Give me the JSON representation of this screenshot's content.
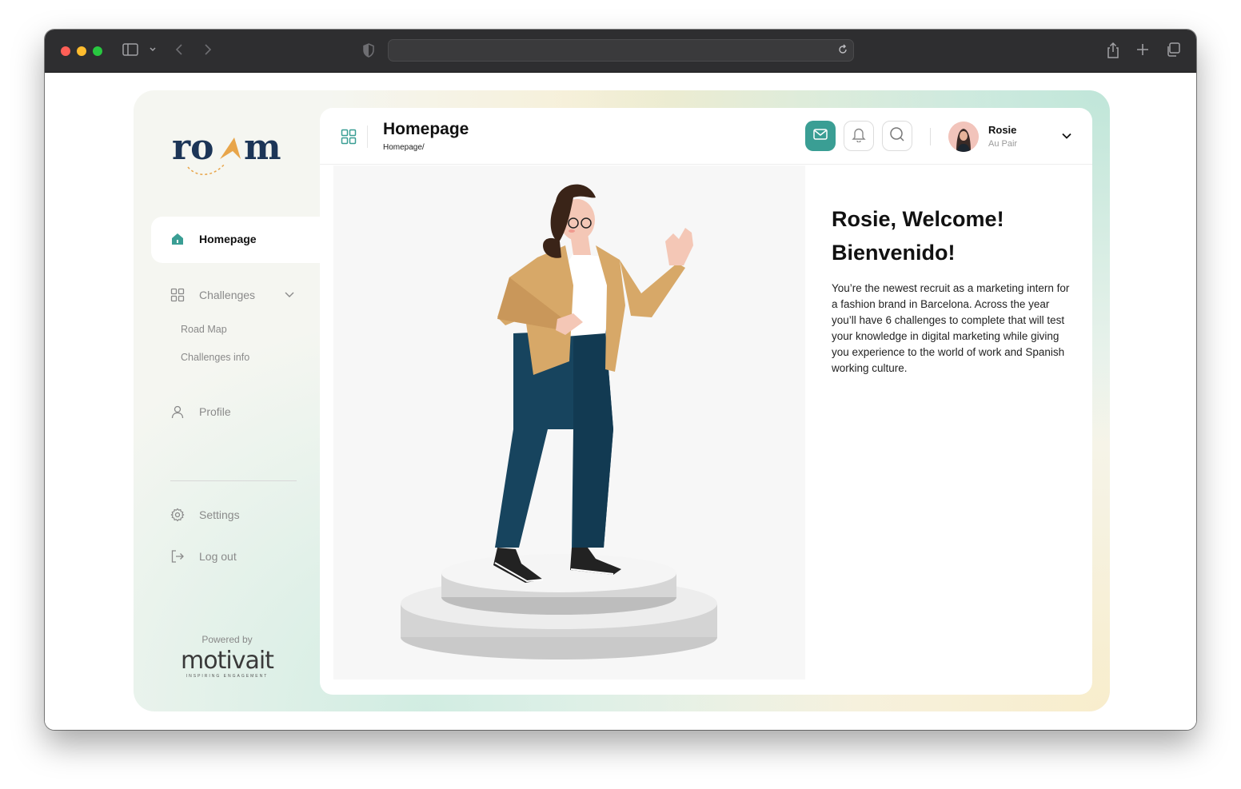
{
  "browser": {
    "url": "",
    "icons": [
      "sidebar-icon",
      "chevron-down-icon",
      "back-icon",
      "forward-icon",
      "shield-icon",
      "reload-icon",
      "share-icon",
      "plus-icon",
      "tabs-icon"
    ]
  },
  "brand": {
    "logo_text": "roam",
    "accent": "#3a9e94",
    "logo_color": "#1c3557",
    "logo_arrow": "#e8a54a"
  },
  "sidebar": {
    "items": [
      {
        "label": "Homepage",
        "icon": "home-icon",
        "active": true
      },
      {
        "label": "Challenges",
        "icon": "grid-icon",
        "expanded": true,
        "children": [
          {
            "label": "Road Map"
          },
          {
            "label": "Challenges info"
          }
        ]
      },
      {
        "label": "Profile",
        "icon": "user-icon"
      }
    ],
    "bottom_items": [
      {
        "label": "Settings",
        "icon": "gear-icon"
      },
      {
        "label": "Log out",
        "icon": "logout-icon"
      }
    ],
    "powered_by": "Powered by",
    "partner_logo": "motivait",
    "partner_tagline": "INSPIRING ENGAGEMENT"
  },
  "header": {
    "title": "Homepage",
    "breadcrumb": "Homepage/",
    "user": {
      "name": "Rosie",
      "role": "Au Pair"
    }
  },
  "content": {
    "welcome_line1": "Rosie, Welcome!",
    "welcome_line2": "Bienvenido!",
    "description": "You’re the newest recruit as a marketing intern for a fashion brand in Barcelona. Across the year you’ll have 6 challenges to complete that will test your knowledge in digital marketing while giving you experience to the world of work and Spanish working culture."
  }
}
